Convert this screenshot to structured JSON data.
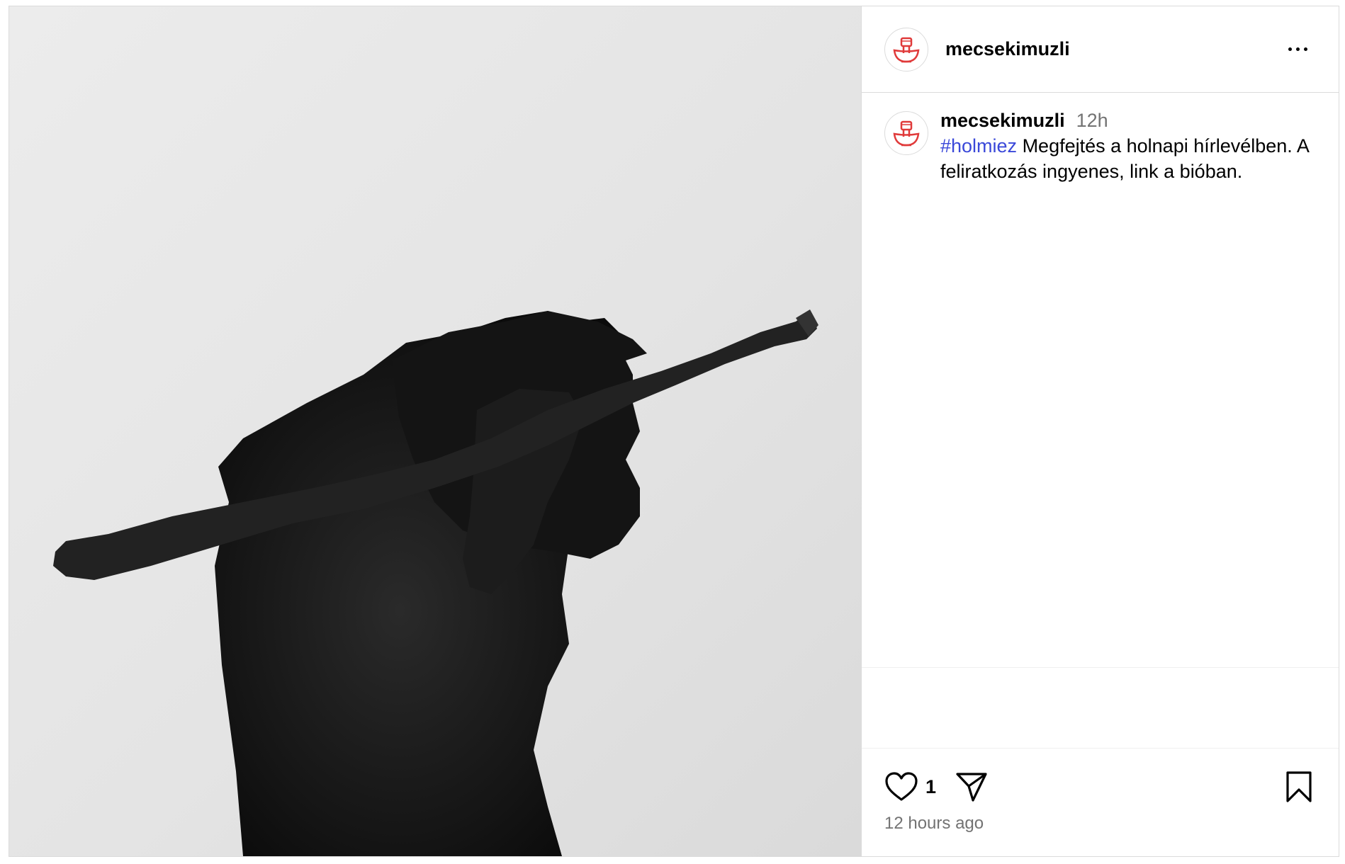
{
  "post": {
    "username": "mecsekimuzli",
    "media_alt_icon": "sculpture-photo",
    "caption": {
      "username": "mecsekimuzli",
      "time": "12h",
      "hashtag": "#holmiez",
      "text": " Megfejtés a holnapi hírlevélben. A feliratkozás ingyenes, link a bióban."
    },
    "likes": "1",
    "timestamp": "12 hours ago"
  },
  "icons": {
    "more": "more-options-icon",
    "like": "heart-icon",
    "share": "share-icon",
    "save": "bookmark-icon",
    "avatar": "bowl-fist-logo"
  },
  "colors": {
    "logo": "#e03a3a",
    "hashtag": "#3a48d9",
    "muted": "#737373",
    "border": "#dbdbdb"
  }
}
